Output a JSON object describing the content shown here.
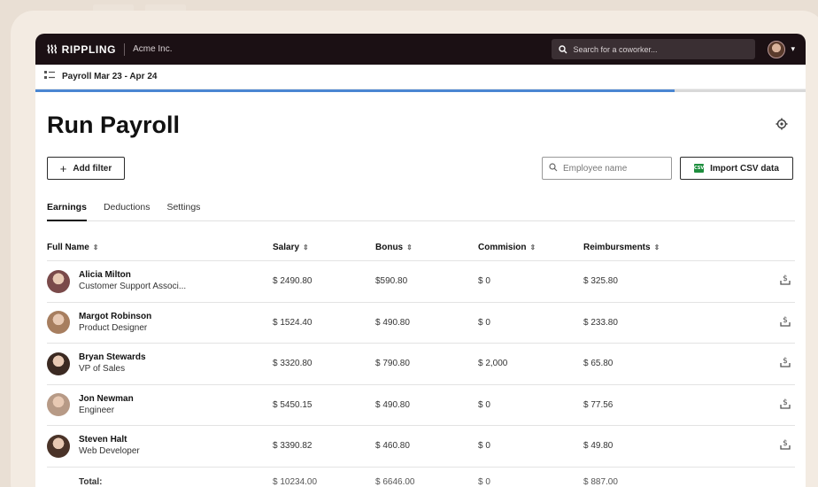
{
  "header": {
    "brand": "RIPPLING",
    "company": "Acme Inc.",
    "search_placeholder": "Search for a coworker..."
  },
  "subbar": {
    "title": "Payroll Mar 23 - Apr 24"
  },
  "progress": {
    "fraction": 0.83
  },
  "page": {
    "title": "Run Payroll"
  },
  "toolbar": {
    "add_filter": "Add filter",
    "employee_placeholder": "Employee name",
    "import_csv": "Import CSV data",
    "csv_icon_text": "CSV"
  },
  "tabs": [
    {
      "label": "Earnings",
      "active": true
    },
    {
      "label": "Deductions",
      "active": false
    },
    {
      "label": "Settings",
      "active": false
    }
  ],
  "table": {
    "columns": [
      "Full Name",
      "Salary",
      "Bonus",
      "Commision",
      "Reimbursments"
    ],
    "rows": [
      {
        "name": "Alicia Milton",
        "role": "Customer Support Associ...",
        "salary": "$ 2490.80",
        "bonus": "$590.80",
        "commission": "$ 0",
        "reimbursements": "$ 325.80",
        "avatar_color": "#7a4a4a"
      },
      {
        "name": "Margot Robinson",
        "role": "Product Designer",
        "salary": "$ 1524.40",
        "bonus": "$ 490.80",
        "commission": "$ 0",
        "reimbursements": "$ 233.80",
        "avatar_color": "#a77e5f"
      },
      {
        "name": "Bryan Stewards",
        "role": "VP of Sales",
        "salary": "$ 3320.80",
        "bonus": "$ 790.80",
        "commission": "$ 2,000",
        "reimbursements": "$ 65.80",
        "avatar_color": "#3b2a22"
      },
      {
        "name": "Jon Newman",
        "role": "Engineer",
        "salary": "$ 5450.15",
        "bonus": "$ 490.80",
        "commission": "$ 0",
        "reimbursements": "$ 77.56",
        "avatar_color": "#b79a86"
      },
      {
        "name": "Steven Halt",
        "role": "Web Developer",
        "salary": "$ 3390.82",
        "bonus": "$ 460.80",
        "commission": "$ 0",
        "reimbursements": "$ 49.80",
        "avatar_color": "#4a3328"
      }
    ],
    "total": {
      "label": "Total:",
      "salary": "$ 10234.00",
      "bonus": "$ 6646.00",
      "commission": "$ 0",
      "reimbursements": "$ 887.00"
    }
  }
}
